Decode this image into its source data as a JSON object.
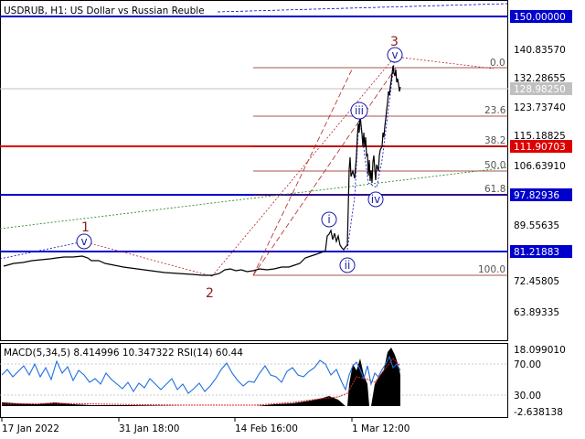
{
  "chart_title": "USDRUB, H1:  US Dollar vs Russian Reuble",
  "indicator_label": "MACD(5,34,5) 8.414996 10.347322 RSI(14) 60.44",
  "price_axis": {
    "ticks": [
      "140.83570",
      "132.28655",
      "123.73740",
      "115.18825",
      "106.63910",
      "89.55635",
      "72.45805",
      "63.89335"
    ],
    "current_price": "128.98250"
  },
  "levels": [
    {
      "label": "150.00000",
      "color": "#0000cc"
    },
    {
      "label": "111.90703",
      "color": "#dd0000"
    },
    {
      "label": "97.82936",
      "color": "#0000cc"
    },
    {
      "label": "81.21883",
      "color": "#0000cc"
    }
  ],
  "fib_levels": [
    "0.0",
    "23.6",
    "38.2",
    "50.0",
    "61.8",
    "100.0"
  ],
  "wave_labels": {
    "red": [
      "1",
      "2",
      "3"
    ],
    "blue": [
      "v",
      "i",
      "ii",
      "iii",
      "iv",
      "v"
    ]
  },
  "subwindow_axis": [
    "18.099010",
    "70.00",
    "30.00",
    "-2.638138"
  ],
  "time_axis": [
    "17 Jan 2022",
    "31 Jan 18:00",
    "14 Feb 16:00",
    "1 Mar 12:00"
  ],
  "colors": {
    "blue": "#0000cc",
    "red": "#dd0000",
    "fib": "#8b1a1a",
    "price_line": "#000000"
  }
}
